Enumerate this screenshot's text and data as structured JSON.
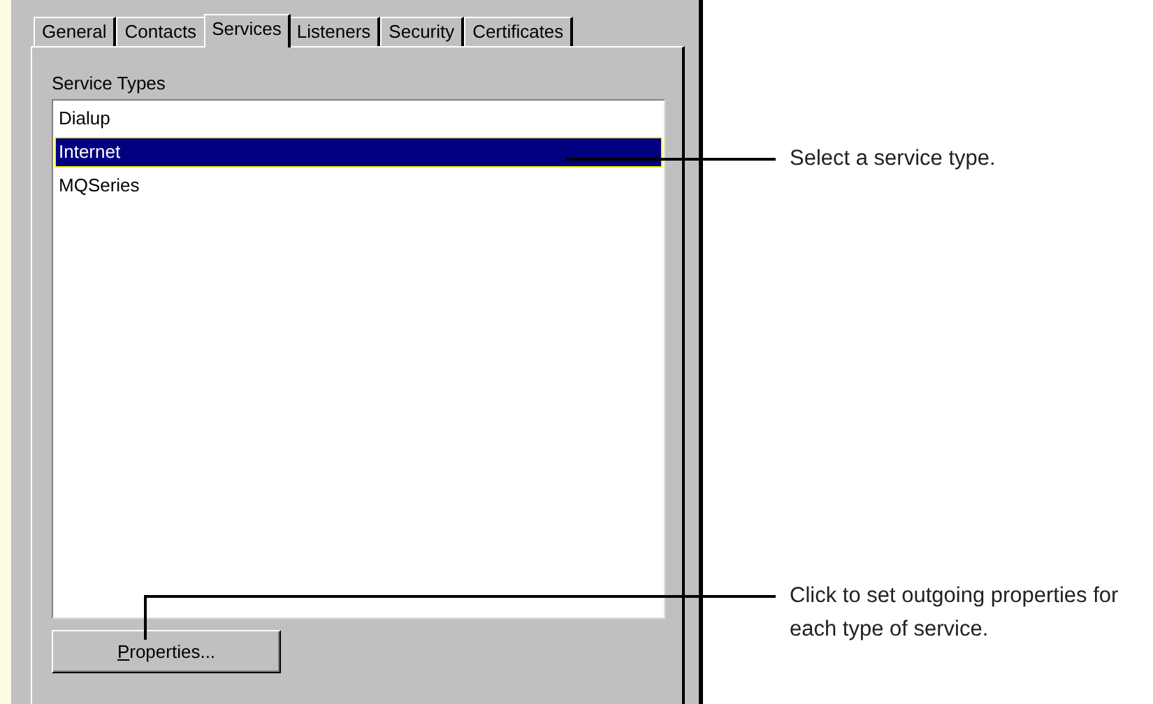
{
  "tabs": [
    {
      "label": "General",
      "selected": false
    },
    {
      "label": "Contacts",
      "selected": false
    },
    {
      "label": "Services",
      "selected": true
    },
    {
      "label": "Listeners",
      "selected": false
    },
    {
      "label": "Security",
      "selected": false
    },
    {
      "label": "Certificates",
      "selected": false
    }
  ],
  "service_types": {
    "label": "Service Types",
    "items": [
      {
        "label": "Dialup",
        "selected": false
      },
      {
        "label": "Internet",
        "selected": true
      },
      {
        "label": "MQSeries",
        "selected": false
      }
    ]
  },
  "properties_button": "Properties...",
  "callouts": [
    {
      "text": "Select a service type."
    },
    {
      "text": "Click to set outgoing properties for each type of service."
    }
  ]
}
